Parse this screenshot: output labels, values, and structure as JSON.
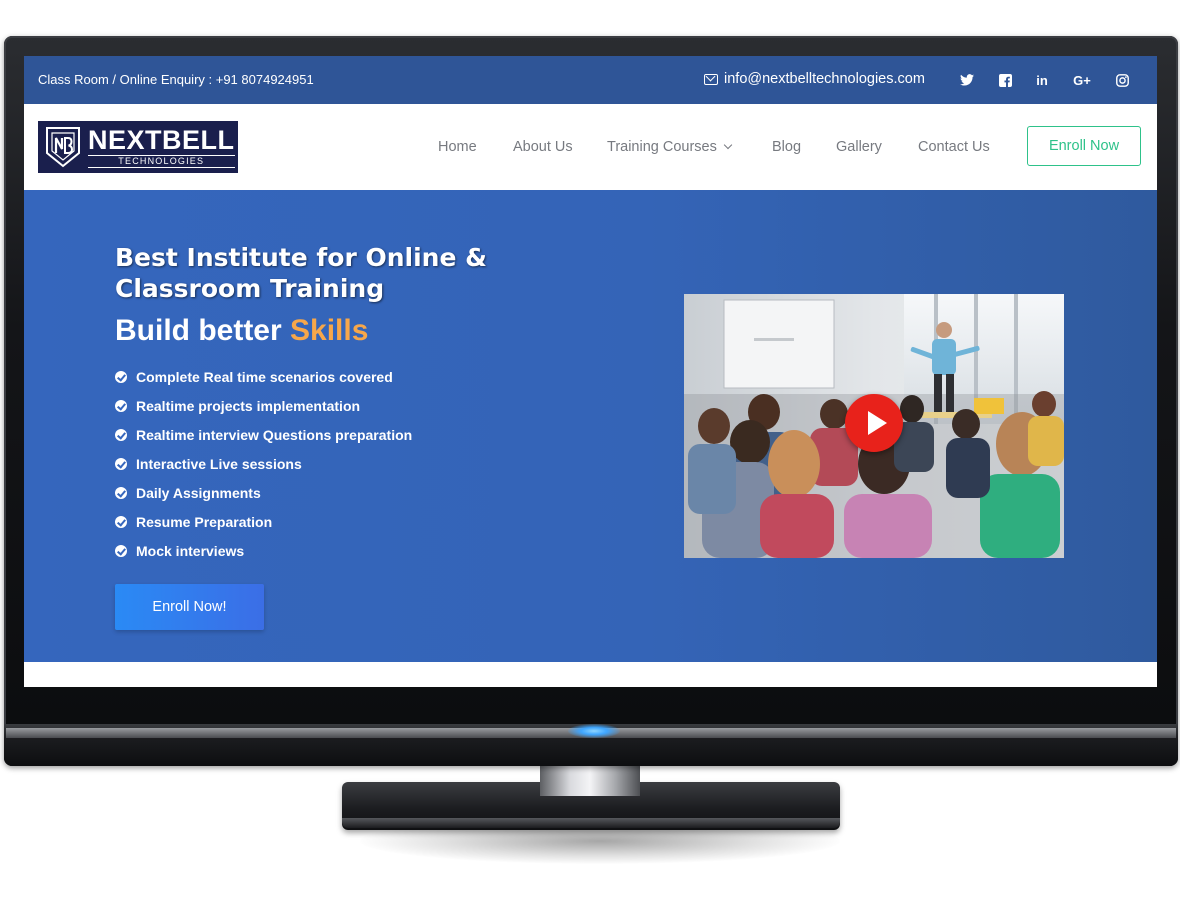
{
  "topbar": {
    "enquiry": "Class Room / Online Enquiry : +91 8074924951",
    "email": "info@nextbelltechnologies.com",
    "social_icons": [
      "twitter-icon",
      "facebook-icon",
      "linkedin-icon",
      "google-plus-icon",
      "instagram-icon"
    ],
    "linkedin_glyph": "in",
    "googleplus_glyph": "G+"
  },
  "brand": {
    "name": "NEXTBELL",
    "sub": "TECHNOLOGIES"
  },
  "nav": {
    "items": [
      "Home",
      "About Us",
      "Training Courses",
      "Blog",
      "Gallery",
      "Contact Us"
    ],
    "enroll": "Enroll Now"
  },
  "hero": {
    "heading_line1": "Best Institute for Online &",
    "heading_line2": "Classroom Training",
    "tagline_prefix": "Build better",
    "tagline_accent": "Skills",
    "features": [
      "Complete Real time scenarios covered",
      "Realtime projects implementation",
      "Realtime interview Questions preparation",
      "Interactive Live sessions",
      "Daily Assignments",
      "Resume Preparation",
      "Mock interviews"
    ],
    "cta": "Enroll Now!"
  },
  "colors": {
    "topbar": "#2f5597",
    "hero": "#3566bd",
    "accent": "#f7a74a",
    "enroll_border": "#2ec28a",
    "play_button": "#e8221b"
  }
}
